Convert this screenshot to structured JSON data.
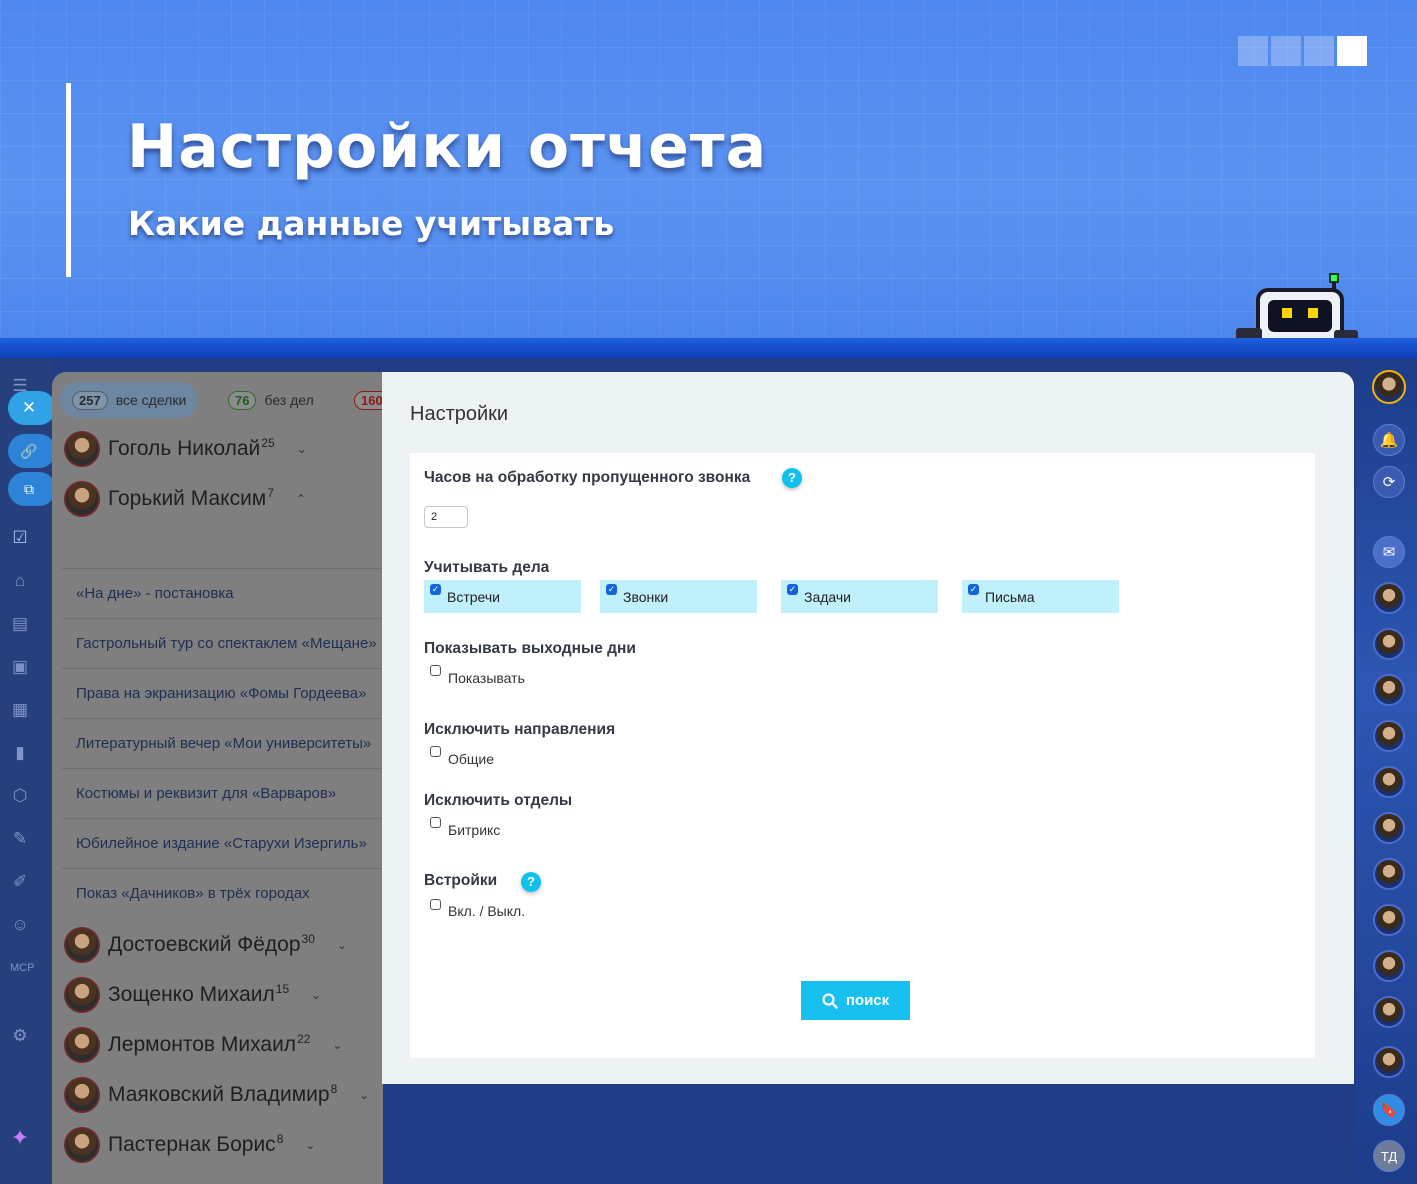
{
  "banner": {
    "title": "Настройки отчета",
    "subtitle": "Какие данные учитывать"
  },
  "filters": [
    {
      "count": "257",
      "label": "все сделки",
      "active": true
    },
    {
      "count": "76",
      "label": "без дел",
      "active": false
    },
    {
      "count": "160",
      "label": "",
      "active": false
    }
  ],
  "people_top": [
    {
      "name": "Гоголь Николай",
      "count": "25",
      "chevron": "⌄"
    },
    {
      "name": "Горький Максим",
      "count": "7",
      "chevron": "⌃"
    }
  ],
  "deals": [
    "«На дне» - постановка",
    "Гастрольный тур со спектаклем «Мещане»",
    "Права на экранизацию «Фомы Гордеева»",
    "Литературный вечер «Мои университеты»",
    "Костюмы и реквизит для «Варваров»",
    "Юбилейное издание «Старухи Изергиль»",
    "Показ «Дачников» в трёх городах"
  ],
  "people_bottom": [
    {
      "name": "Достоевский Фёдор",
      "count": "30"
    },
    {
      "name": "Зощенко Михаил",
      "count": "15"
    },
    {
      "name": "Лермонтов Михаил",
      "count": "22"
    },
    {
      "name": "Маяковский Владимир",
      "count": "8"
    },
    {
      "name": "Пастернак Борис",
      "count": "8"
    }
  ],
  "right_rail": {
    "initials": "ТД"
  },
  "settings": {
    "title": "Настройки",
    "missed_call": {
      "label": "Часов на обработку пропущенного звонка",
      "value": "2",
      "help": "?"
    },
    "activities": {
      "label": "Учитывать дела",
      "options": [
        {
          "label": "Встречи",
          "checked": true
        },
        {
          "label": "Звонки",
          "checked": true
        },
        {
          "label": "Задачи",
          "checked": true
        },
        {
          "label": "Письма",
          "checked": true
        }
      ]
    },
    "weekends": {
      "label": "Показывать выходные дни",
      "option": "Показывать"
    },
    "exclude_directions": {
      "label": "Исключить направления",
      "option": "Общие"
    },
    "exclude_departments": {
      "label": "Исключить отделы",
      "option": "Битрикс"
    },
    "embeds": {
      "label": "Встройки",
      "option": "Вкл. / Выкл.",
      "help": "?"
    },
    "search_button": "поиск"
  },
  "colors": {
    "accent": "#17c0ee",
    "checkbox_bg": "#bff0fc",
    "banner": "#5b93f2"
  }
}
